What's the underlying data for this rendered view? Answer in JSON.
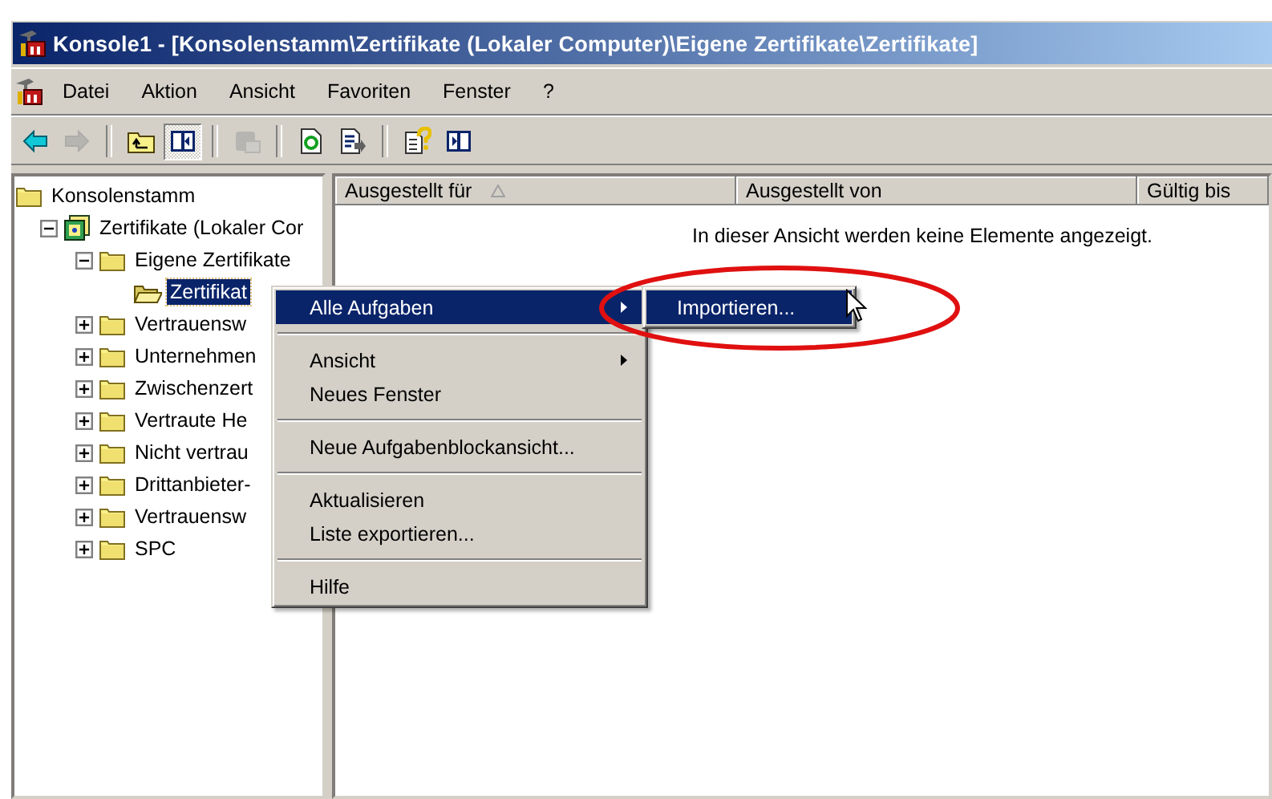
{
  "window": {
    "title": "Konsole1 - [Konsolenstamm\\Zertifikate (Lokaler Computer)\\Eigene Zertifikate\\Zertifikate]"
  },
  "menu_bar": [
    {
      "label": "Datei"
    },
    {
      "label": "Aktion"
    },
    {
      "label": "Ansicht"
    },
    {
      "label": "Favoriten"
    },
    {
      "label": "Fenster"
    },
    {
      "label": "?"
    }
  ],
  "toolbar": [
    {
      "kind": "back",
      "disabled": false,
      "pressed": false
    },
    {
      "kind": "forward",
      "disabled": true,
      "pressed": false
    },
    {
      "kind": "separator"
    },
    {
      "kind": "up",
      "disabled": false,
      "pressed": false
    },
    {
      "kind": "tree-toggle",
      "disabled": false,
      "pressed": true
    },
    {
      "kind": "separator"
    },
    {
      "kind": "delete",
      "disabled": true,
      "pressed": false
    },
    {
      "kind": "separator"
    },
    {
      "kind": "refresh",
      "disabled": false,
      "pressed": false
    },
    {
      "kind": "export",
      "disabled": false,
      "pressed": false
    },
    {
      "kind": "separator"
    },
    {
      "kind": "help",
      "disabled": false,
      "pressed": false
    },
    {
      "kind": "action-pane",
      "disabled": false,
      "pressed": false
    }
  ],
  "tree": [
    {
      "label": "Konsolenstamm",
      "kind": "folder",
      "selected": false,
      "children": [
        {
          "label": "Zertifikate (Lokaler Cor",
          "kind": "store",
          "selected": false,
          "expanded": true,
          "children": [
            {
              "label": "Eigene Zertifikate",
              "kind": "folder",
              "selected": false,
              "expanded": true,
              "children": [
                {
                  "label": "Zertifikat",
                  "kind": "folder",
                  "selected": true
                }
              ]
            },
            {
              "label": "Vertrauensw",
              "kind": "folder",
              "selected": false,
              "expanded": false
            },
            {
              "label": "Unternehmen",
              "kind": "folder",
              "selected": false,
              "expanded": false
            },
            {
              "label": "Zwischenzert",
              "kind": "folder",
              "selected": false,
              "expanded": false
            },
            {
              "label": "Vertraute He",
              "kind": "folder",
              "selected": false,
              "expanded": false
            },
            {
              "label": "Nicht vertrau",
              "kind": "folder",
              "selected": false,
              "expanded": false
            },
            {
              "label": "Drittanbieter-",
              "kind": "folder",
              "selected": false,
              "expanded": false
            },
            {
              "label": "Vertrauensw",
              "kind": "folder",
              "selected": false,
              "expanded": false
            },
            {
              "label": "SPC",
              "kind": "folder",
              "selected": false,
              "expanded": false
            }
          ]
        }
      ]
    }
  ],
  "list": {
    "columns": [
      {
        "label": "Ausgestellt für",
        "sorted": true
      },
      {
        "label": "Ausgestellt von",
        "sorted": false
      },
      {
        "label": "Gültig bis",
        "sorted": false
      }
    ],
    "empty_message": "In dieser Ansicht werden keine Elemente angezeigt."
  },
  "context_menu": {
    "items": [
      {
        "kind": "item",
        "label": "Alle Aufgaben",
        "selected": true,
        "submenu": true
      },
      {
        "kind": "separator"
      },
      {
        "kind": "item",
        "label": "Ansicht",
        "selected": false,
        "submenu": true
      },
      {
        "kind": "item",
        "label": "Neues Fenster",
        "selected": false,
        "submenu": false
      },
      {
        "kind": "separator"
      },
      {
        "kind": "item",
        "label": "Neue Aufgabenblockansicht...",
        "selected": false,
        "submenu": false
      },
      {
        "kind": "separator"
      },
      {
        "kind": "item",
        "label": "Aktualisieren",
        "selected": false,
        "submenu": false
      },
      {
        "kind": "item",
        "label": "Liste exportieren...",
        "selected": false,
        "submenu": false
      },
      {
        "kind": "separator"
      },
      {
        "kind": "item",
        "label": "Hilfe",
        "selected": false,
        "submenu": false
      }
    ],
    "submenu_items": [
      {
        "label": "Importieren...",
        "selected": true
      }
    ]
  }
}
